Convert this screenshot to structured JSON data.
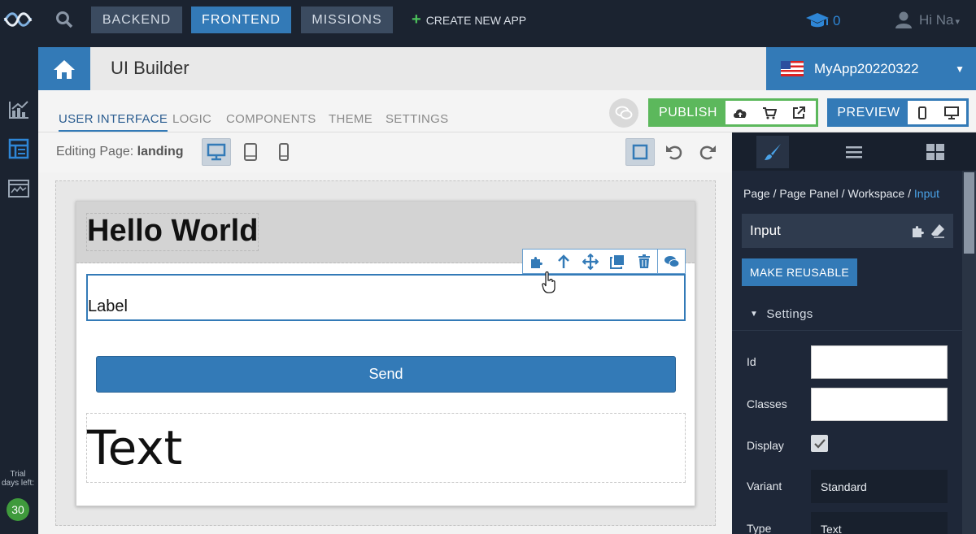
{
  "topbar": {
    "tabs": [
      {
        "label": "BACKEND"
      },
      {
        "label": "FRONTEND"
      },
      {
        "label": "MISSIONS"
      }
    ],
    "create_app": "CREATE NEW APP",
    "score": "0",
    "user": "Hi Na"
  },
  "header": {
    "title": "UI Builder",
    "app_name": "MyApp20220322"
  },
  "tabs": [
    {
      "label": "USER INTERFACE"
    },
    {
      "label": "LOGIC"
    },
    {
      "label": "COMPONENTS"
    },
    {
      "label": "THEME"
    },
    {
      "label": "SETTINGS"
    }
  ],
  "actions": {
    "publish": "PUBLISH",
    "preview": "PREVIEW"
  },
  "editing": {
    "prefix": "Editing Page:",
    "page": "landing"
  },
  "canvas": {
    "heading": "Hello World",
    "input_label": "Label",
    "button": "Send",
    "text": "Text"
  },
  "panel": {
    "breadcrumb": [
      "Page",
      "Page Panel",
      "Workspace"
    ],
    "breadcrumb_current": "Input",
    "component": "Input",
    "make_reusable": "MAKE REUSABLE",
    "settings_title": "Settings",
    "fields": {
      "id": "Id",
      "classes": "Classes",
      "display": "Display",
      "variant": "Variant",
      "variant_value": "Standard",
      "type": "Type",
      "type_value": "Text"
    }
  },
  "trial": {
    "line1": "Trial",
    "line2": "days left:",
    "days": "30"
  },
  "colors": {
    "primary": "#337ab7",
    "publish": "#5cb85c",
    "dark": "#1b2330",
    "panel": "#1e2738"
  }
}
